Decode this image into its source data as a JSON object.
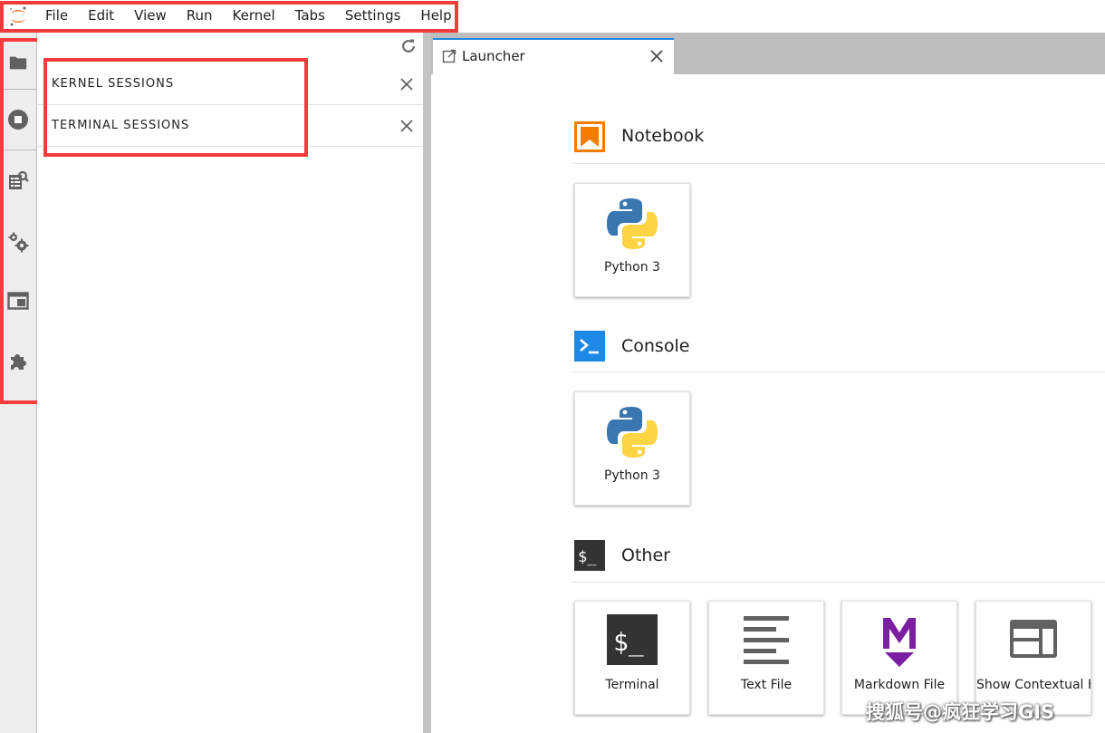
{
  "menubar": {
    "items": [
      "File",
      "Edit",
      "View",
      "Run",
      "Kernel",
      "Tabs",
      "Settings",
      "Help"
    ]
  },
  "activitybar": {
    "icons": [
      "folder-icon",
      "stop-circle-icon",
      "property-inspector-icon",
      "gears-icon",
      "tab-window-icon",
      "puzzle-extension-icon"
    ]
  },
  "sidepanel": {
    "sections": [
      {
        "title": "KERNEL SESSIONS"
      },
      {
        "title": "TERMINAL SESSIONS"
      }
    ]
  },
  "tabs": [
    {
      "label": "Launcher",
      "active": true
    }
  ],
  "launcher": {
    "categories": [
      {
        "title": "Notebook",
        "cards": [
          {
            "label": "Python 3",
            "icon": "python-logo-icon"
          }
        ]
      },
      {
        "title": "Console",
        "cards": [
          {
            "label": "Python 3",
            "icon": "python-logo-icon"
          }
        ]
      },
      {
        "title": "Other",
        "cards": [
          {
            "label": "Terminal",
            "icon": "terminal-icon"
          },
          {
            "label": "Text File",
            "icon": "text-file-icon"
          },
          {
            "label": "Markdown File",
            "icon": "markdown-icon"
          },
          {
            "label": "Show Contextual Help",
            "icon": "contextual-help-icon"
          }
        ]
      }
    ]
  },
  "watermark": "搜狐号@疯狂学习GIS",
  "colors": {
    "highlight": "#f53b3b",
    "notebook_orange": "#f57c00",
    "console_blue": "#1e88e5",
    "terminal_dark": "#333333",
    "markdown_purple": "#7b1fa2",
    "tab_accent": "#1e88e5"
  }
}
